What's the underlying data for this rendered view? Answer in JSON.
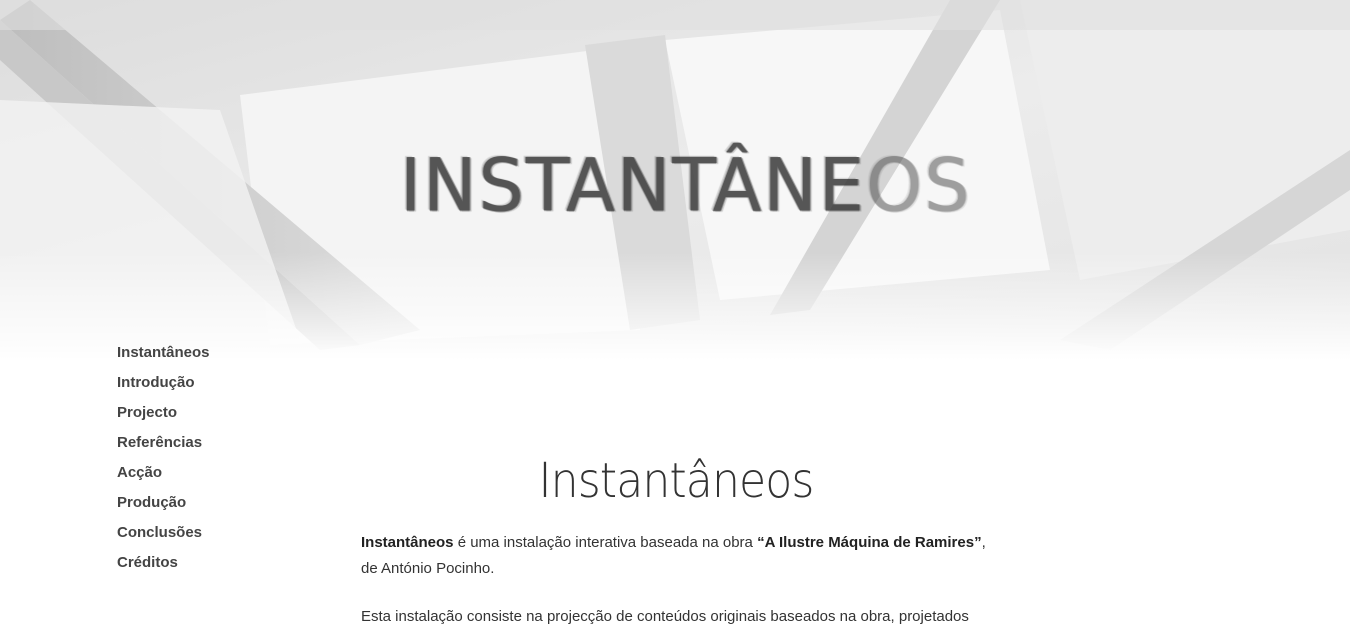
{
  "hero": {
    "title_main": "INSTANTÂNE",
    "title_fade": "OS"
  },
  "nav": {
    "items": [
      {
        "label": "Instantâneos"
      },
      {
        "label": "Introdução"
      },
      {
        "label": "Projecto"
      },
      {
        "label": "Referências"
      },
      {
        "label": "Acção"
      },
      {
        "label": "Produção"
      },
      {
        "label": "Conclusões"
      },
      {
        "label": "Créditos"
      }
    ]
  },
  "main": {
    "heading": "Instantâneos",
    "paragraph1": {
      "bold_start": "Instantâneos",
      "text_middle": " é uma instalação interativa baseada na obra ",
      "bold_title": "“A Ilustre Máquina de Ramires”",
      "text_end": ", de António Pocinho."
    },
    "paragraph2": "Esta instalação consiste na projecção de conteúdos originais baseados na obra, projetados"
  },
  "colors": {
    "text": "#333333",
    "nav_text": "#444444",
    "hero_bg": "#e8e8e8"
  }
}
